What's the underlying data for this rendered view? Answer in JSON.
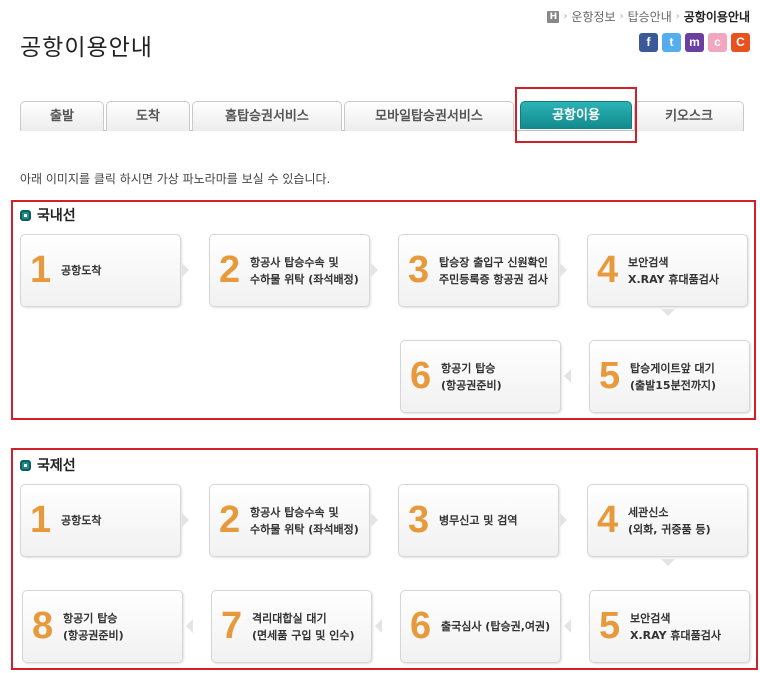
{
  "header": {
    "title": "공항이용안내",
    "breadcrumb": [
      "운항정보",
      "탑승안내",
      "공항이용안내"
    ],
    "home_icon_label": "H",
    "social_icons": [
      {
        "name": "facebook",
        "glyph": "f",
        "color": "#3b5998"
      },
      {
        "name": "twitter",
        "glyph": "t",
        "color": "#55acee"
      },
      {
        "name": "me2day",
        "glyph": "m",
        "color": "#6b3fa0"
      },
      {
        "name": "cyworld",
        "glyph": "c",
        "color": "#f2a6c0"
      },
      {
        "name": "clog",
        "glyph": "C",
        "color": "#e8521e"
      }
    ]
  },
  "tabs": [
    {
      "label": "출발",
      "active": false
    },
    {
      "label": "도착",
      "active": false
    },
    {
      "label": "홈탑승권서비스",
      "active": false
    },
    {
      "label": "모바일탑승권서비스",
      "active": false
    },
    {
      "label": "공항이용",
      "active": true
    },
    {
      "label": "키오스크",
      "active": false
    }
  ],
  "intro_text": "아래 이미지를 클릭 하시면 가상 파노라마를 보실 수 있습니다.",
  "domestic": {
    "title": "국내선",
    "steps": [
      {
        "num": "1",
        "label": "공항도착"
      },
      {
        "num": "2",
        "label": "항공사 탑승수속 및\n수하물 위탁 (좌석배정)"
      },
      {
        "num": "3",
        "label": "탑승장 출입구 신원확인\n주민등록증 항공권 검사"
      },
      {
        "num": "4",
        "label": "보안검색\nX.RAY 휴대품검사"
      },
      {
        "num": "5",
        "label": "탑승게이트앞 대기\n(출발15분전까지)"
      },
      {
        "num": "6",
        "label": "항공기 탑승\n(항공권준비)"
      }
    ]
  },
  "international": {
    "title": "국제선",
    "steps": [
      {
        "num": "1",
        "label": "공항도착"
      },
      {
        "num": "2",
        "label": "항공사 탑승수속 및\n수하물 위탁 (좌석배정)"
      },
      {
        "num": "3",
        "label": "병무신고 및 검역"
      },
      {
        "num": "4",
        "label": "세관신소\n(외화, 귀중품 등)"
      },
      {
        "num": "5",
        "label": "보안검색\nX.RAY 휴대품검사"
      },
      {
        "num": "6",
        "label": "출국심사 (탑승권,여권)"
      },
      {
        "num": "7",
        "label": "격리대합실 대기\n(면세품 구입 및 인수)"
      },
      {
        "num": "8",
        "label": "항공기 탑승\n(항공권준비)"
      }
    ]
  },
  "colors": {
    "accent": "#1a9fa2",
    "highlight": "#d0202c",
    "step_number": "#e69a3c"
  }
}
